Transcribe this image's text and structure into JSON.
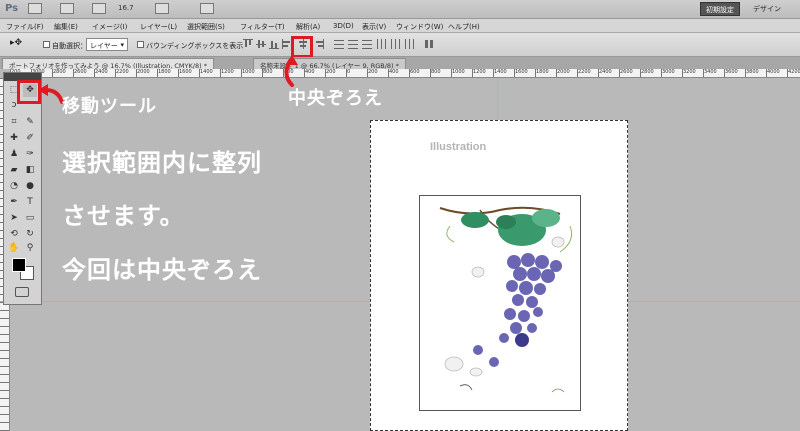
{
  "app": {
    "logo": "Ps",
    "zoom": "16.7",
    "workspace_active": "初期設定",
    "workspace_other": "デザイン"
  },
  "menu": [
    "ファイル(F)",
    "編集(E)",
    "イメージ(I)",
    "レイヤー(L)",
    "選択範囲(S)",
    "フィルター(T)",
    "解析(A)",
    "3D(D)",
    "表示(V)",
    "ウィンドウ(W)",
    "ヘルプ(H)"
  ],
  "options": {
    "auto_select_label": "自動選択：",
    "auto_select_value": "レイヤー",
    "bounding_box_label": "バウンディングボックスを表示"
  },
  "tabs": [
    "ポートフォリオを作ってみよう @ 16.7% (Illustration, CMYK/8) *",
    "名称未設定 1 @ 66.7% (レイヤー 9, RGB/8) *"
  ],
  "ruler_ticks": [
    "200",
    "3000",
    "2800",
    "2600",
    "2400",
    "2200",
    "2000",
    "1800",
    "1600",
    "1400",
    "1200",
    "1000",
    "800",
    "600",
    "400",
    "200",
    "0",
    "200",
    "400",
    "600",
    "800",
    "1000",
    "1200",
    "1400",
    "1600",
    "1800",
    "2000",
    "2200",
    "2400",
    "2600",
    "2800",
    "3000",
    "3200",
    "3400",
    "3600",
    "3800",
    "4000",
    "4200",
    "4400"
  ],
  "canvas": {
    "doc_label": "Illustration"
  },
  "annotations": {
    "move_tool": "移動ツール",
    "center_align": "中央ぞろえ",
    "line1": "選択範囲内に整列",
    "line2": "させます。",
    "line3": "今回は中央ぞろえ"
  },
  "colors": {
    "highlight_red": "#e01a22",
    "guide_cyan": "#55d6e6",
    "grape_purple": "#6a66b3",
    "leaf_green": "#2f8e62"
  }
}
